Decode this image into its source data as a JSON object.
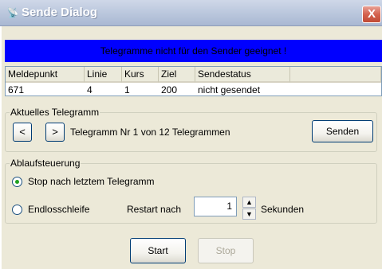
{
  "window": {
    "title": "Sende Dialog",
    "close_glyph": "X",
    "icon": "antenna-icon",
    "accent_color": "#0000ff"
  },
  "banner": {
    "message": "Telegramme nicht für den Sender geeignet !"
  },
  "table": {
    "columns": [
      "Meldepunkt",
      "Linie",
      "Kurs",
      "Ziel",
      "Sendestatus"
    ],
    "rows": [
      [
        "671",
        "4",
        "1",
        "200",
        "nicht gesendet"
      ]
    ]
  },
  "current": {
    "group_label": "Aktuelles Telegramm",
    "prev_label": "<",
    "next_label": ">",
    "info": "Telegramm Nr 1 von 12 Telegrammen",
    "send_label": "Senden"
  },
  "flow": {
    "group_label": "Ablaufsteuerung",
    "option_stop": "Stop nach letztem Telegramm",
    "option_loop": "Endlosschleife",
    "restart_label": "Restart nach",
    "restart_value": "1",
    "seconds_label": "Sekunden",
    "selected_option": "stop"
  },
  "footer": {
    "start_label": "Start",
    "stop_label": "Stop"
  }
}
